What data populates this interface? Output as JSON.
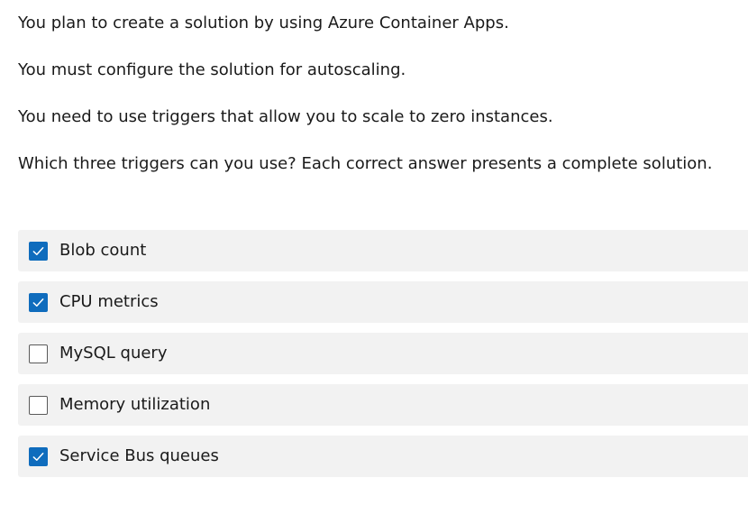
{
  "question": {
    "lines": [
      "You plan to create a solution by using Azure Container Apps.",
      "You must configure the solution for autoscaling.",
      "You need to use triggers that allow you to scale to zero instances.",
      "Which three triggers can you use? Each correct answer presents a complete solution."
    ]
  },
  "options": [
    {
      "label": "Blob count",
      "checked": true
    },
    {
      "label": "CPU metrics",
      "checked": true
    },
    {
      "label": "MySQL query",
      "checked": false
    },
    {
      "label": "Memory utilization",
      "checked": false
    },
    {
      "label": "Service Bus queues",
      "checked": true
    }
  ],
  "colors": {
    "checkbox_checked": "#0f6cbd",
    "option_background": "#f2f2f2"
  },
  "icons": {
    "checked_mark": "checkmark-icon"
  }
}
